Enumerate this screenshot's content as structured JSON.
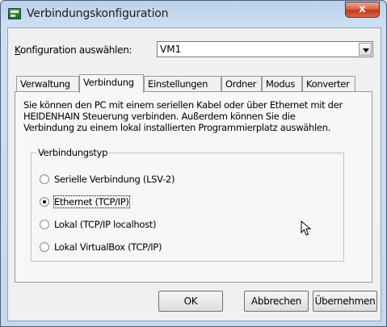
{
  "window": {
    "title": "Verbindungskonfiguration",
    "close_label": "x"
  },
  "config": {
    "label": "Konfiguration auswählen:",
    "selected_value": "VM1"
  },
  "tabs": [
    {
      "label": "Verwaltung",
      "active": false
    },
    {
      "label": "Verbindung",
      "active": true
    },
    {
      "label": "Einstellungen",
      "active": false
    },
    {
      "label": "Ordner",
      "active": false
    },
    {
      "label": "Modus",
      "active": false
    },
    {
      "label": "Konverter",
      "active": false
    }
  ],
  "panel": {
    "description_lines": [
      "Sie können den PC mit einem seriellen Kabel oder über Ethernet mit der",
      "HEIDENHAIN Steuerung verbinden. Außerdem können Sie die",
      "Verbindung zu einem lokal installierten Programmierplatz auswählen."
    ],
    "group_title": "Verbindungstyp",
    "options": [
      {
        "label": "Serielle Verbindung (LSV-2)",
        "checked": false
      },
      {
        "label": "Ethernet (TCP/IP)",
        "checked": true
      },
      {
        "label": "Lokal (TCP/IP localhost)",
        "checked": false
      },
      {
        "label": "Lokal VirtualBox (TCP/IP)",
        "checked": false
      }
    ]
  },
  "buttons": {
    "ok": "OK",
    "cancel": "Abbrechen",
    "apply": "Übernehmen"
  },
  "icons": {
    "app": "app-icon",
    "cursor": "mouse-pointer-icon"
  }
}
